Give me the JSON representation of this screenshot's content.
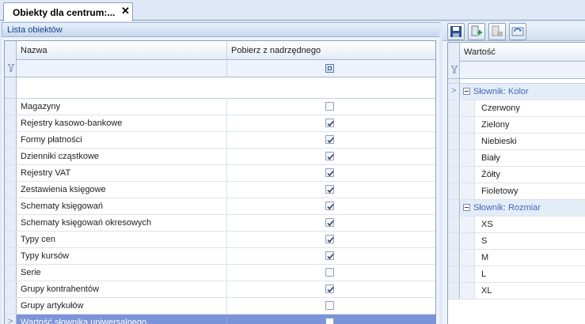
{
  "tab": {
    "title": "Obiekty dla centrum:...",
    "close": "✕"
  },
  "left_panel": {
    "title": "Lista obiektów",
    "columns": {
      "name": "Nazwa",
      "inherit": "Pobierz z nadrzędnego"
    },
    "rows": [
      {
        "name": "Magazyny",
        "checked": false
      },
      {
        "name": "Rejestry kasowo-bankowe",
        "checked": true
      },
      {
        "name": "Formy płatności",
        "checked": true
      },
      {
        "name": "Dzienniki cząstkowe",
        "checked": true
      },
      {
        "name": "Rejestry VAT",
        "checked": true
      },
      {
        "name": "Zestawienia księgowe",
        "checked": true
      },
      {
        "name": "Schematy księgowań",
        "checked": true
      },
      {
        "name": "Schematy księgowań okresowych",
        "checked": true
      },
      {
        "name": "Typy cen",
        "checked": true
      },
      {
        "name": "Typy kursów",
        "checked": true
      },
      {
        "name": "Serie",
        "checked": false
      },
      {
        "name": "Grupy kontrahentów",
        "checked": true
      },
      {
        "name": "Grupy artykułów",
        "checked": false
      },
      {
        "name": "Wartość słownika uniwersalnego",
        "checked": false,
        "selected": true
      }
    ]
  },
  "right_panel": {
    "toolbar": [
      "save-icon",
      "add-icon",
      "remove-icon",
      "refresh-icon"
    ],
    "column": "Wartość",
    "rows": [
      {
        "type": "group",
        "label": "Słownik: Kolor",
        "current": true
      },
      {
        "type": "value",
        "label": "Czerwony"
      },
      {
        "type": "value",
        "label": "Zielony"
      },
      {
        "type": "value",
        "label": "Niebieski"
      },
      {
        "type": "value",
        "label": "Biały"
      },
      {
        "type": "value",
        "label": "Żółty"
      },
      {
        "type": "value",
        "label": "Fioletowy"
      },
      {
        "type": "group",
        "label": "Słownik: Rozmiar"
      },
      {
        "type": "value",
        "label": "XS"
      },
      {
        "type": "value",
        "label": "S"
      },
      {
        "type": "value",
        "label": "M"
      },
      {
        "type": "value",
        "label": "L"
      },
      {
        "type": "value",
        "label": "XL"
      }
    ]
  },
  "colors": {
    "selection": "#7b93d8",
    "group_text": "#3f6bb5",
    "header_text": "#15428b"
  }
}
